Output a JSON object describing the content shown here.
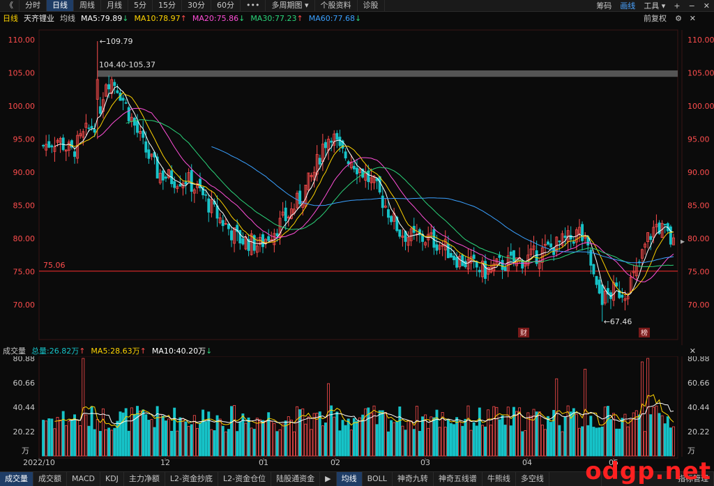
{
  "topbar": {
    "back": "《",
    "tabs": [
      "分时",
      "日线",
      "周线",
      "月线",
      "5分",
      "15分",
      "30分",
      "60分",
      "•••",
      "多周期图 ▾",
      "个股资料",
      "诊股"
    ],
    "active_index": 1,
    "right": [
      "筹码",
      "画线",
      "工具 ▾",
      "+",
      "−",
      "✕"
    ]
  },
  "main_header": {
    "period": "日线",
    "stock": "天齐锂业",
    "avg": "均线",
    "ma5": "MA5:79.89",
    "ma10": "MA10:78.97",
    "ma20": "MA20:75.86",
    "ma30": "MA30:77.23",
    "ma60": "MA60:77.68",
    "fq": "前复权",
    "colors": {
      "ma5": "#ffffff",
      "ma10": "#ffd400",
      "ma20": "#ff4fd8",
      "ma30": "#2bd47a",
      "ma60": "#3aa0ff",
      "up": "#ff4d4d",
      "down": "#16c3c8"
    }
  },
  "price_axis": {
    "labels": [
      "110.00",
      "105.00",
      "100.00",
      "95.00",
      "90.00",
      "85.00",
      "80.00",
      "75.00",
      "70.00"
    ]
  },
  "annotations": {
    "high": "←109.79",
    "range": "104.40-105.37",
    "line": "75.06",
    "low": "←67.46",
    "badge1": "财",
    "badge2": "榜"
  },
  "volume_header": {
    "title": "成交量",
    "total": "总量:26.82万",
    "ma5": "MA5:28.63万",
    "ma10": "MA10:40.20万"
  },
  "volume_axis": {
    "labels": [
      "80.88",
      "60.66",
      "40.44",
      "20.22"
    ],
    "unit": "万"
  },
  "date_axis": {
    "labels": [
      "2022/10",
      "12",
      "01",
      "02",
      "03",
      "04",
      "05"
    ]
  },
  "bottombar": {
    "tabs": [
      "成交量",
      "成交额",
      "MACD",
      "KDJ",
      "主力净额",
      "L2-资金抄底",
      "L2-资金仓位",
      "陆股通资金",
      "▶",
      "均线",
      "BOLL",
      "神奇九转",
      "神奇五线谱",
      "牛熊线",
      "多空线",
      "",
      "指标管理"
    ],
    "active": [
      0,
      9
    ]
  },
  "watermark": "odgp.net"
}
